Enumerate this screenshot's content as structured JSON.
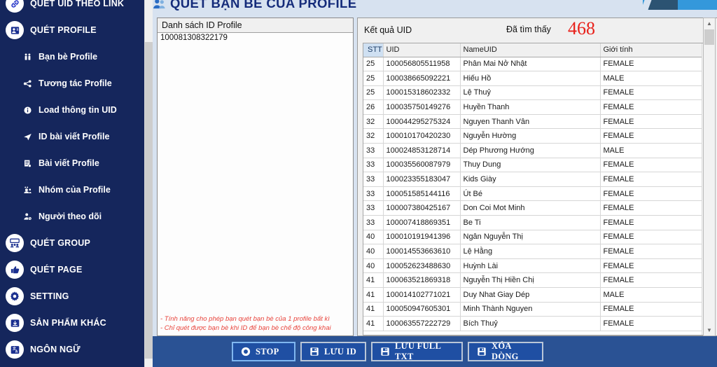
{
  "sidebar": {
    "items": [
      {
        "label": "QUÉT UID THEO LINK",
        "icon": "link-icon",
        "level": "top"
      },
      {
        "label": "QUÉT PROFILE",
        "icon": "profile-card-icon",
        "level": "top"
      },
      {
        "label": "Bạn bè Profile",
        "icon": "friends-icon",
        "level": "sub"
      },
      {
        "label": "Tương tác Profile",
        "icon": "interaction-icon",
        "level": "sub"
      },
      {
        "label": "Load thông tin UID",
        "icon": "info-icon",
        "level": "sub"
      },
      {
        "label": "ID bài viết Profile",
        "icon": "send-icon",
        "level": "sub"
      },
      {
        "label": "Bài viết Profile",
        "icon": "post-icon",
        "level": "sub"
      },
      {
        "label": "Nhóm của Profile",
        "icon": "group-icon",
        "level": "sub"
      },
      {
        "label": "Người theo dõi",
        "icon": "follower-icon",
        "level": "sub"
      },
      {
        "label": "QUÉT GROUP",
        "icon": "group-scan-icon",
        "level": "top"
      },
      {
        "label": "QUÉT PAGE",
        "icon": "page-scan-icon",
        "level": "top"
      },
      {
        "label": "SETTING",
        "icon": "gear-icon",
        "level": "top"
      },
      {
        "label": "SẢN PHẨM KHÁC",
        "icon": "download-box-icon",
        "level": "top"
      },
      {
        "label": "NGÔN NGỮ",
        "icon": "language-icon",
        "level": "top"
      }
    ]
  },
  "header": {
    "title": "QUÉT BẠN BÈ CỦA PROFILE",
    "icon": "people-icon"
  },
  "list_panel": {
    "header": "Danh sách ID Profile",
    "value": "100081308322179",
    "notes": [
      "- Tính năng cho phép bạn quét bạn bè của 1 profile bất kì",
      "- Chỉ quét được bạn bè khi ID để bạn bè chế độ công khai"
    ]
  },
  "result_panel": {
    "header": "Kết quả UID",
    "found_label": "Đã tìm thấy",
    "found_count": "468",
    "count_color": "#e8201a",
    "columns": [
      "STT",
      "UID",
      "NameUID",
      "Giới tính"
    ],
    "selected_column": "STT",
    "rows": [
      {
        "stt": "25",
        "uid": "100056805511958",
        "name": "Phân Mai Nở Nhật",
        "gender": "FEMALE"
      },
      {
        "stt": "25",
        "uid": "100038665092221",
        "name": "Hiếu Hồ",
        "gender": "MALE"
      },
      {
        "stt": "25",
        "uid": "100015318602332",
        "name": "Lệ Thuỷ",
        "gender": "FEMALE"
      },
      {
        "stt": "26",
        "uid": "100035750149276",
        "name": "Huyền Thanh",
        "gender": "FEMALE"
      },
      {
        "stt": "32",
        "uid": "100044295275324",
        "name": "Nguyen Thanh Vân",
        "gender": "FEMALE"
      },
      {
        "stt": "32",
        "uid": "100010170420230",
        "name": "Nguyễn Hường",
        "gender": "FEMALE"
      },
      {
        "stt": "33",
        "uid": "100024853128714",
        "name": "Dép Phương Hướng",
        "gender": "MALE"
      },
      {
        "stt": "33",
        "uid": "100035560087979",
        "name": "Thuy Dung",
        "gender": "FEMALE"
      },
      {
        "stt": "33",
        "uid": "100023355183047",
        "name": "Kids Giày",
        "gender": "FEMALE"
      },
      {
        "stt": "33",
        "uid": "100051585144116",
        "name": "Út Bé",
        "gender": "FEMALE"
      },
      {
        "stt": "33",
        "uid": "100007380425167",
        "name": "Don Coi Mot Minh",
        "gender": "FEMALE"
      },
      {
        "stt": "33",
        "uid": "100007418869351",
        "name": "Be Ti",
        "gender": "FEMALE"
      },
      {
        "stt": "40",
        "uid": "100010191941396",
        "name": "Ngân Nguyễn Thị",
        "gender": "FEMALE"
      },
      {
        "stt": "40",
        "uid": "100014553663610",
        "name": "Lệ Hằng",
        "gender": "FEMALE"
      },
      {
        "stt": "40",
        "uid": "100052623488630",
        "name": "Huỳnh Lài",
        "gender": "FEMALE"
      },
      {
        "stt": "41",
        "uid": "100063521869318",
        "name": "Nguyễn Thị Hiền Chị",
        "gender": "FEMALE"
      },
      {
        "stt": "41",
        "uid": "100014102771021",
        "name": "Duy Nhat Giay Dép",
        "gender": "MALE"
      },
      {
        "stt": "41",
        "uid": "100050947605301",
        "name": "Minh Thành Nguyen",
        "gender": "FEMALE"
      },
      {
        "stt": "41",
        "uid": "100063557222729",
        "name": "Bích Thuỷ",
        "gender": "FEMALE"
      }
    ]
  },
  "bottom_bar": {
    "buttons": [
      {
        "label": "STOP",
        "icon": "stop-circle-icon"
      },
      {
        "label": "LƯU ID",
        "icon": "save-icon"
      },
      {
        "label": "LƯU FULL TXT",
        "icon": "save-icon"
      },
      {
        "label": "XÓA DÒNG",
        "icon": "save-icon"
      }
    ]
  },
  "colors": {
    "sidebar_bg": "#15265c",
    "panel_bg": "#d7e2f0",
    "bottom_bar": "#2a5294",
    "button_bg": "#1f4fa3",
    "title": "#142b7a",
    "accent_red": "#e8201a"
  }
}
